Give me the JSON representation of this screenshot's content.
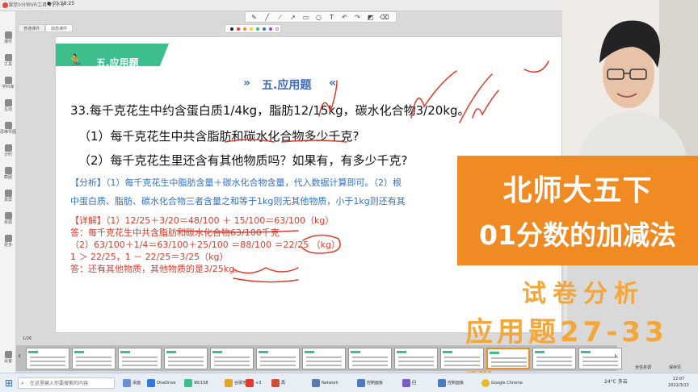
{
  "titlebar": {
    "app_title": "课堂0分钟VR工具 V1.7 0",
    "timer": "● 01:58:25"
  },
  "left_rail": {
    "items": [
      {
        "label": "课件"
      },
      {
        "label": "工具"
      },
      {
        "label": "学科库"
      },
      {
        "label": "互动"
      },
      {
        "label": "思维导图"
      },
      {
        "label": "计时"
      },
      {
        "label": "截图"
      },
      {
        "label": "录屏"
      },
      {
        "label": "资源"
      },
      {
        "label": "更多"
      }
    ],
    "bottom_label": "设置"
  },
  "tabs": [
    {
      "label": "普通课件"
    },
    {
      "label": "动态课件"
    }
  ],
  "slide": {
    "banner_title": "五.应用题",
    "heading": "五.应用题",
    "chevron_left": "»",
    "chevron_right": "«",
    "question": "33.每千克花生中约含蛋白质1/4kg，脂肪12/15kg，碳水化合物3/20kg。",
    "q1": "（1）每千克花生中共含脂肪和碳水化合物多少千克?",
    "q2": "（2）每千克花生里还含有其他物质吗？如果有，有多少千克?",
    "analysis_1": "【分析】（1）每千克花生中脂肪含量＋碳水化合物含量，代入数据计算即可。（2）根",
    "analysis_2": "中蛋白质、脂肪、碳水化合物三者含量之和等于1kg则无其他物质，小于1kg则还有其",
    "solution_1": "【详解】（1）12/25＋3/20＝48/100 ＋ 15/100＝63/100（kg）",
    "solution_2": "答：每千克花生中共含脂肪和碳水化合物63/100千克",
    "solution_3": "（2）63/100＋1/4＝63/100＋25/100 ＝88/100 ＝22/25 （kg）",
    "solution_4": "1 ＞ 22/25，1 － 22/25＝3/25（kg）",
    "solution_5": "答：还有其他物质，其他物质的是3/25kg。"
  },
  "overlay": {
    "line1": "北师大五下",
    "line2": "01分数的加减法",
    "sub1": "试卷分析",
    "sub2": "应用题27-33题"
  },
  "thumbnail_strip": {
    "page_indicator": "1/26",
    "count": 13,
    "active_index": 10
  },
  "side_buttons": {
    "left": "全任务调",
    "right": "保存页"
  },
  "taskbar": {
    "search_placeholder": "在这里输入你要搜索的内容",
    "apps": [
      {
        "label": "桌面"
      },
      {
        "label": "OneDrive"
      },
      {
        "label": "96/158"
      },
      {
        "label": "谷歌地"
      },
      {
        "label": "+3"
      },
      {
        "label": "再"
      },
      {
        "label": "Network"
      },
      {
        "label": "控制面板"
      },
      {
        "label": "回"
      },
      {
        "label": "控制面板"
      },
      {
        "label": "Google Chrome"
      }
    ],
    "weather": "24°C 多云",
    "time": "12:07",
    "date": "2022/3/13"
  },
  "colors": {
    "banner": "#3dbf8d",
    "overlay_orange": "#f08a22",
    "subtitle_orange": "#f3a63a",
    "ink_red": "#e03a2b",
    "analysis_blue": "#3273c8"
  }
}
